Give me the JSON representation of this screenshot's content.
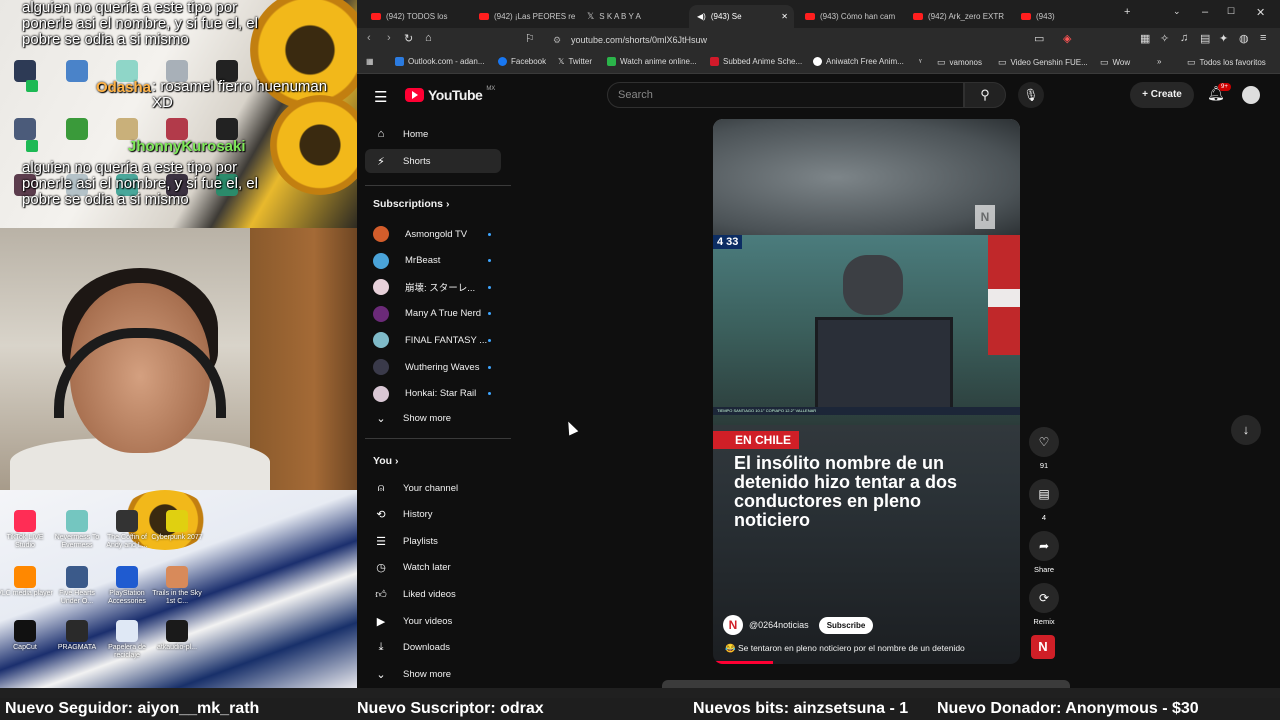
{
  "browser": {
    "tabs": [
      {
        "label": "(942) TODOS los"
      },
      {
        "label": "(942) ¡Las PEORES re"
      },
      {
        "label": "S K A B Y A"
      },
      {
        "label": "(943) Se",
        "active": true
      },
      {
        "label": "(943) Cómo han cam"
      },
      {
        "label": "(942) Ark_zero EXTR"
      },
      {
        "label": "(943)"
      }
    ],
    "url": "youtube.com/shorts/0mlX6JtHsuw",
    "bookmarks": [
      {
        "label": "Outlook.com - adan..."
      },
      {
        "label": "Facebook"
      },
      {
        "label": "Twitter"
      },
      {
        "label": "Watch anime online..."
      },
      {
        "label": "Subbed Anime Sche..."
      },
      {
        "label": "Aniwatch Free Anim..."
      },
      {
        "label": "vamonos"
      },
      {
        "label": "Video Genshin FUE..."
      },
      {
        "label": "Wow"
      },
      {
        "label": "Todos los favoritos"
      }
    ]
  },
  "youtube": {
    "logo_text": "YouTube",
    "region": "MX",
    "search_placeholder": "Search",
    "create_label": "Create",
    "notif_count": "9+",
    "sidebar": {
      "home": "Home",
      "shorts": "Shorts",
      "subscriptions_header": "Subscriptions",
      "subscriptions": [
        {
          "name": "Asmongold TV",
          "color": "#d35d2b"
        },
        {
          "name": "MrBeast",
          "color": "#4aa3d8"
        },
        {
          "name": "崩壊: スターレ...",
          "color": "#e7d0d9"
        },
        {
          "name": "Many A True Nerd",
          "color": "#6b2a78"
        },
        {
          "name": "FINAL FANTASY ...",
          "color": "#7fbac8"
        },
        {
          "name": "Wuthering Waves",
          "color": "#3a3a4a"
        },
        {
          "name": "Honkai: Star Rail",
          "color": "#d9c7d4"
        }
      ],
      "show_more": "Show more",
      "you_header": "You",
      "you_items": [
        {
          "label": "Your channel",
          "icon": "person-icon"
        },
        {
          "label": "History",
          "icon": "history-icon"
        },
        {
          "label": "Playlists",
          "icon": "playlist-icon"
        },
        {
          "label": "Watch later",
          "icon": "clock-icon"
        },
        {
          "label": "Liked videos",
          "icon": "thumbs-up-icon"
        },
        {
          "label": "Your videos",
          "icon": "video-icon"
        },
        {
          "label": "Downloads",
          "icon": "download-icon"
        }
      ],
      "show_more_2": "Show more"
    },
    "short": {
      "news_time": "4 33",
      "ticker": "TIEMPO   SANTIAGO  10.1°  COPIAPO  12.2°  VALLENAR",
      "tag": "EN CHILE",
      "headline": "El insólito nombre de un detenido hizo tentar a dos conductores en pleno noticiero",
      "channel": "@0264noticias",
      "subscribe": "Subscribe",
      "caption": "😂 Se tentaron en pleno noticiero por el nombre de un detenido",
      "likes": "91",
      "comments": "4",
      "share": "Share",
      "remix": "Remix"
    }
  },
  "overlay": {
    "chat": [
      {
        "text": "alguien no quería a este tipo por ponerle asi el nombre, y si fue el, el pobre se odia a si mismo"
      },
      {
        "user": "Odasha",
        "text": ": rosamel fierro huenuman XD"
      },
      {
        "user": "JhonnyKurosaki",
        "text": "alguien no quería a este tipo por ponerle asi el nombre, y si fue el, el pobre se odia a si mismo"
      }
    ],
    "desktop_icons": [
      {
        "label": "TikTok LIVE Studio"
      },
      {
        "label": "Nevermess To Evermess"
      },
      {
        "label": "The Coffin of Andy and L..."
      },
      {
        "label": "Cyberpunk 2077"
      },
      {
        "label": "VLC media player"
      },
      {
        "label": "Five Hearts Under O..."
      },
      {
        "label": "PlayStation Accessories"
      },
      {
        "label": "Trails in the Sky 1st C..."
      },
      {
        "label": "CapCut"
      },
      {
        "label": "PRAGMATA"
      },
      {
        "label": "Papelera de reciclaje"
      },
      {
        "label": "atkaudio-pl..."
      }
    ]
  },
  "ticker": [
    "Nuevo Seguidor: aiyon__mk_rath",
    "Nuevo Suscriptor: odrax",
    "Nuevos bits: ainzsetsuna - 1",
    "Nuevo Donador: Anonymous - $30"
  ]
}
